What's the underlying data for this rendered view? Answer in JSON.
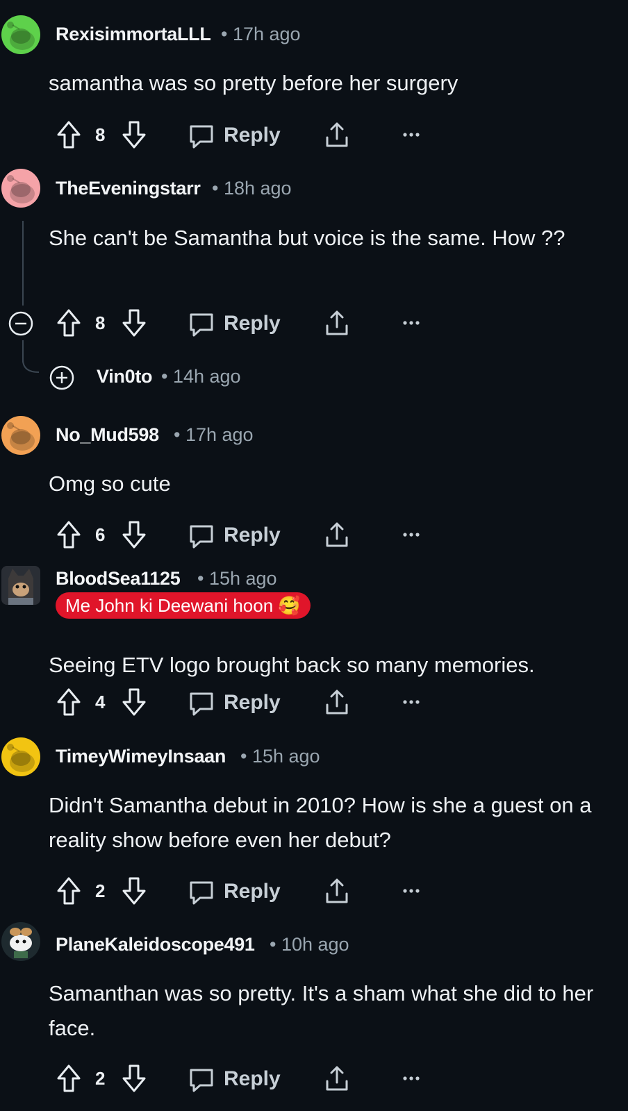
{
  "comments": [
    {
      "username": "RexisimmortaLLL",
      "time": "17h ago",
      "text": "samantha was so pretty before her surgery",
      "votes": "8",
      "reply": "Reply",
      "avatar_color": "#5ed14b"
    },
    {
      "username": "TheEveningstarr",
      "time": "18h ago",
      "text": "She can't be Samantha but voice is the same. How ??",
      "votes": "8",
      "reply": "Reply",
      "avatar_color": "#f5a3a8"
    },
    {
      "username": "No_Mud598",
      "time": "17h ago",
      "text": "Omg so cute",
      "votes": "6",
      "reply": "Reply",
      "avatar_color": "#f2a154"
    },
    {
      "username": "BloodSea1125",
      "time": "15h ago",
      "flair": "Me John ki Deewani hoon 🥰",
      "text": "Seeing ETV logo brought back so many memories.",
      "votes": "4",
      "reply": "Reply",
      "avatar_color": "#2a2e35"
    },
    {
      "username": "TimeyWimeyInsaan",
      "time": "15h ago",
      "text": "Didn't Samantha debut in 2010? How is she a guest on a reality show before even her debut?",
      "votes": "2",
      "reply": "Reply",
      "avatar_color": "#f2c412"
    },
    {
      "username": "PlaneKaleidoscope491",
      "time": "10h ago",
      "text": "Samanthan was so pretty. It's a sham what she did to her face.",
      "votes": "2",
      "reply": "Reply",
      "avatar_color": "#1e2a2f"
    }
  ],
  "collapsed_reply": {
    "username": "Vin0to",
    "time": "14h ago"
  },
  "separator": "•",
  "icons": {
    "upvote": "arrow-up-icon",
    "downvote": "arrow-down-icon",
    "reply": "speech-bubble-icon",
    "share": "share-icon",
    "more": "more-dots-icon",
    "collapse": "minus-circle-icon",
    "expand": "plus-circle-icon"
  }
}
